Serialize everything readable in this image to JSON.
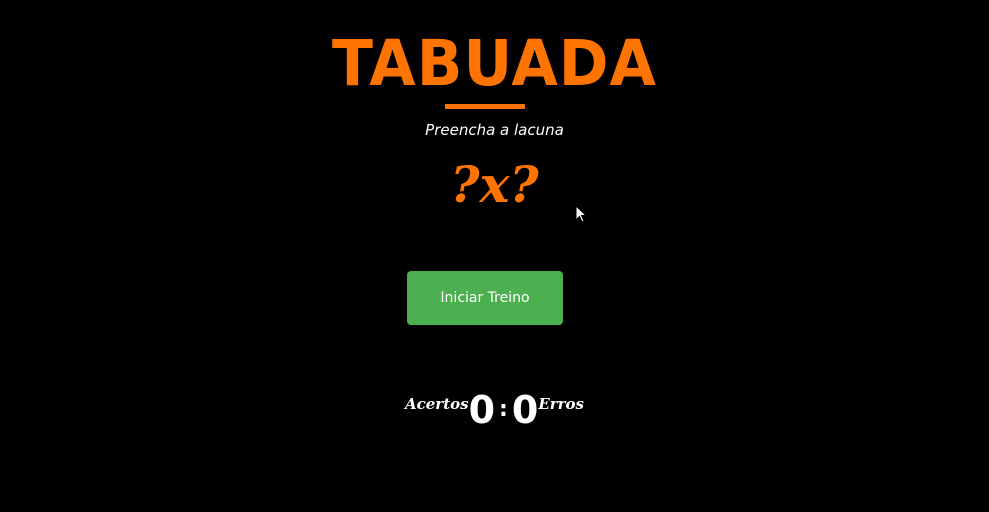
{
  "app": {
    "title": "TABUADA",
    "subtitle": "Preencha a lacuna",
    "accent_color": "#ff7300"
  },
  "question": {
    "left": "?",
    "operator": "x",
    "right": "?"
  },
  "start_button": {
    "label": "Iniciar Treino",
    "color": "#4caf50"
  },
  "score": {
    "correct_label": "Acertos",
    "correct": "0",
    "separator": ":",
    "errors": "0",
    "errors_label": "Erros"
  },
  "icons": {
    "cursor": "mouse-pointer-icon"
  }
}
